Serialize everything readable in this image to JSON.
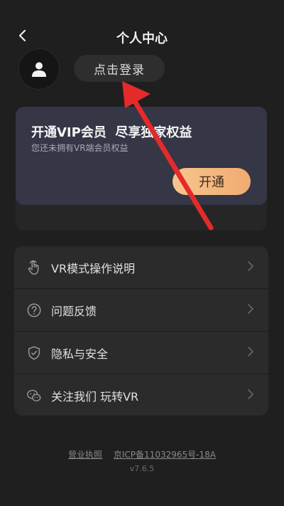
{
  "header": {
    "title": "个人中心"
  },
  "user": {
    "login_label": "点击登录"
  },
  "vip": {
    "title": "开通VIP会员  尽享独家权益",
    "subtitle": "您还未拥有VR端会员权益",
    "button_label": "开通",
    "accent_color": "#f3b67f"
  },
  "menu": {
    "items": [
      {
        "label": "VR模式操作说明",
        "icon": "hand-pointer-icon"
      },
      {
        "label": "问题反馈",
        "icon": "question-circle-icon"
      },
      {
        "label": "隐私与安全",
        "icon": "shield-check-icon"
      },
      {
        "label": "关注我们 玩转VR",
        "icon": "wechat-icon"
      }
    ]
  },
  "footer": {
    "license_link": "营业执照",
    "icp_link": "京ICP备11032965号-18A",
    "version": "v7.6.5"
  },
  "annotation": {
    "color": "#e52a2a"
  }
}
